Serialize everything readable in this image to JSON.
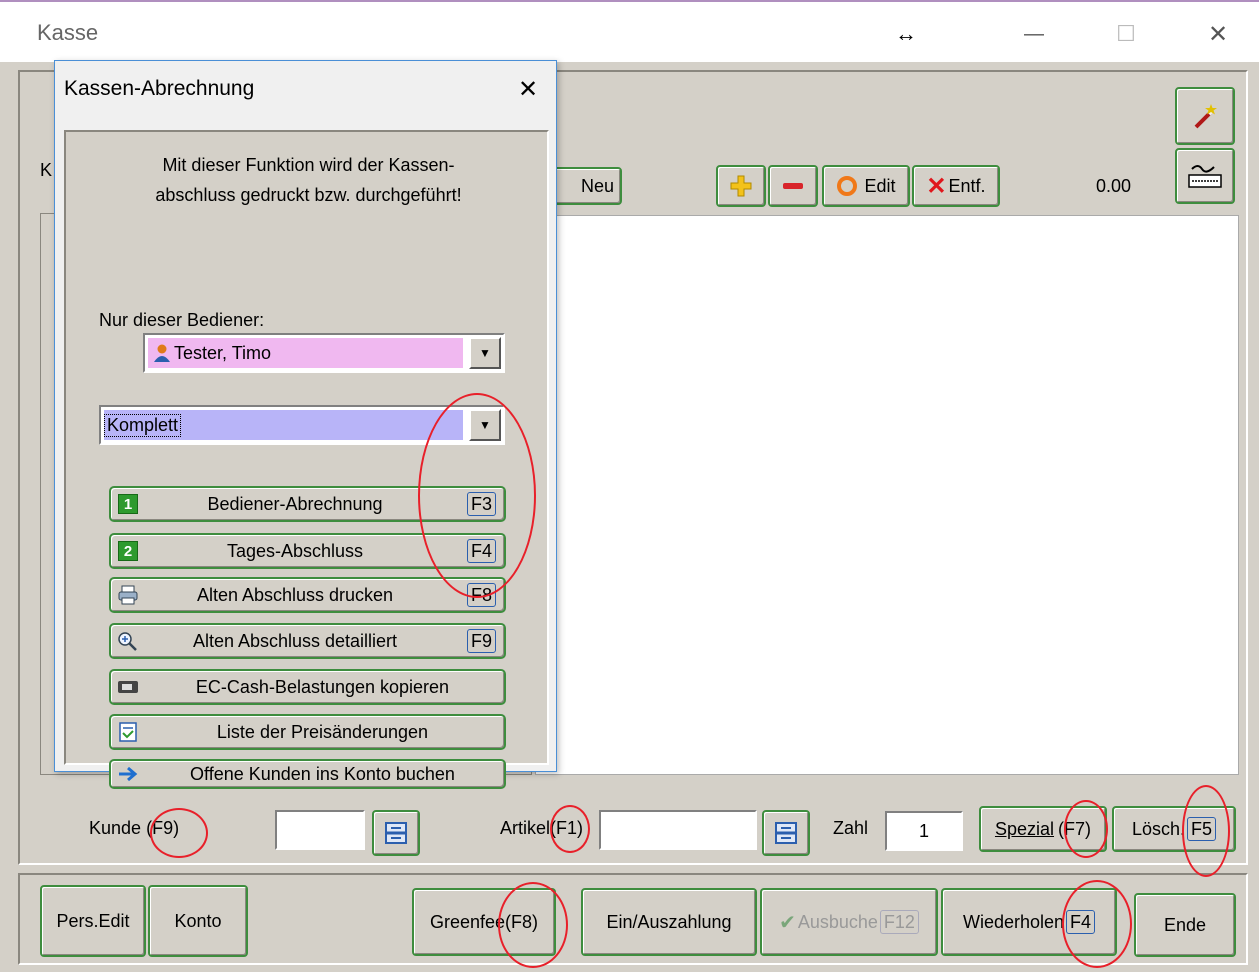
{
  "window": {
    "title": "Kasse",
    "resize_glyph": "↔",
    "minimize_glyph": "—",
    "maximize_glyph": "☐",
    "close_glyph": "✕"
  },
  "toolbar": {
    "partial_label": "K",
    "new_label": "Neu",
    "edit_label": "Edit",
    "delete_label": "Entf.",
    "total_value": "0.00"
  },
  "input_row": {
    "customer_label": "Kunde",
    "customer_key": "(F9)",
    "article_label": "Artikel",
    "article_key": "(F1)",
    "count_label": "Zahl",
    "count_value": "1",
    "special_label": "Spezial",
    "special_key": "(F7)",
    "delete_label": "Lösch.",
    "delete_key": "F5"
  },
  "bottom_bar": {
    "pers_edit": "Pers.Edit",
    "account": "Konto",
    "greenfee": "Greenfee",
    "greenfee_key": "(F8)",
    "cash_in_out": "Ein/Auszahlung",
    "book_out": "Ausbuche",
    "book_out_key": "F12",
    "repeat": "Wiederholen",
    "repeat_key": "F4",
    "end": "Ende"
  },
  "dialog": {
    "title": "Kassen-Abrechnung",
    "close_glyph": "✕",
    "intro_line1": "Mit dieser Funktion wird der Kassen-",
    "intro_line2": "abschluss gedruckt bzw. durchgeführt!",
    "operator_label": "Nur dieser Bediener:",
    "operator_value": "Tester, Timo",
    "mode_value": "Komplett",
    "buttons": [
      {
        "label": "Bediener-Abrechnung",
        "key": "F3",
        "icon": "badge-1-icon"
      },
      {
        "label": "Tages-Abschluss",
        "key": "F4",
        "icon": "badge-2-icon"
      },
      {
        "label": "Alten Abschluss drucken",
        "key": "F8",
        "icon": "printer-icon"
      },
      {
        "label": "Alten Abschluss detailliert",
        "key": "F9",
        "icon": "magnifier-icon"
      },
      {
        "label": "EC-Cash-Belastungen kopieren",
        "icon": "card-icon"
      },
      {
        "label": "Liste der Preisänderungen",
        "icon": "list-icon"
      },
      {
        "label": "Offene Kunden ins Konto buchen",
        "icon": "arrow-right-icon"
      }
    ],
    "badge_1": "1",
    "badge_2": "2"
  },
  "colors": {
    "window_bg": "#d4d0c8",
    "button_border": "#3e8d3e",
    "operator_combo_bg": "#f0b8f0",
    "mode_combo_bg": "#b8b4f8",
    "annotation_ring": "#e8202a",
    "dialog_border": "#4a8fd6"
  }
}
